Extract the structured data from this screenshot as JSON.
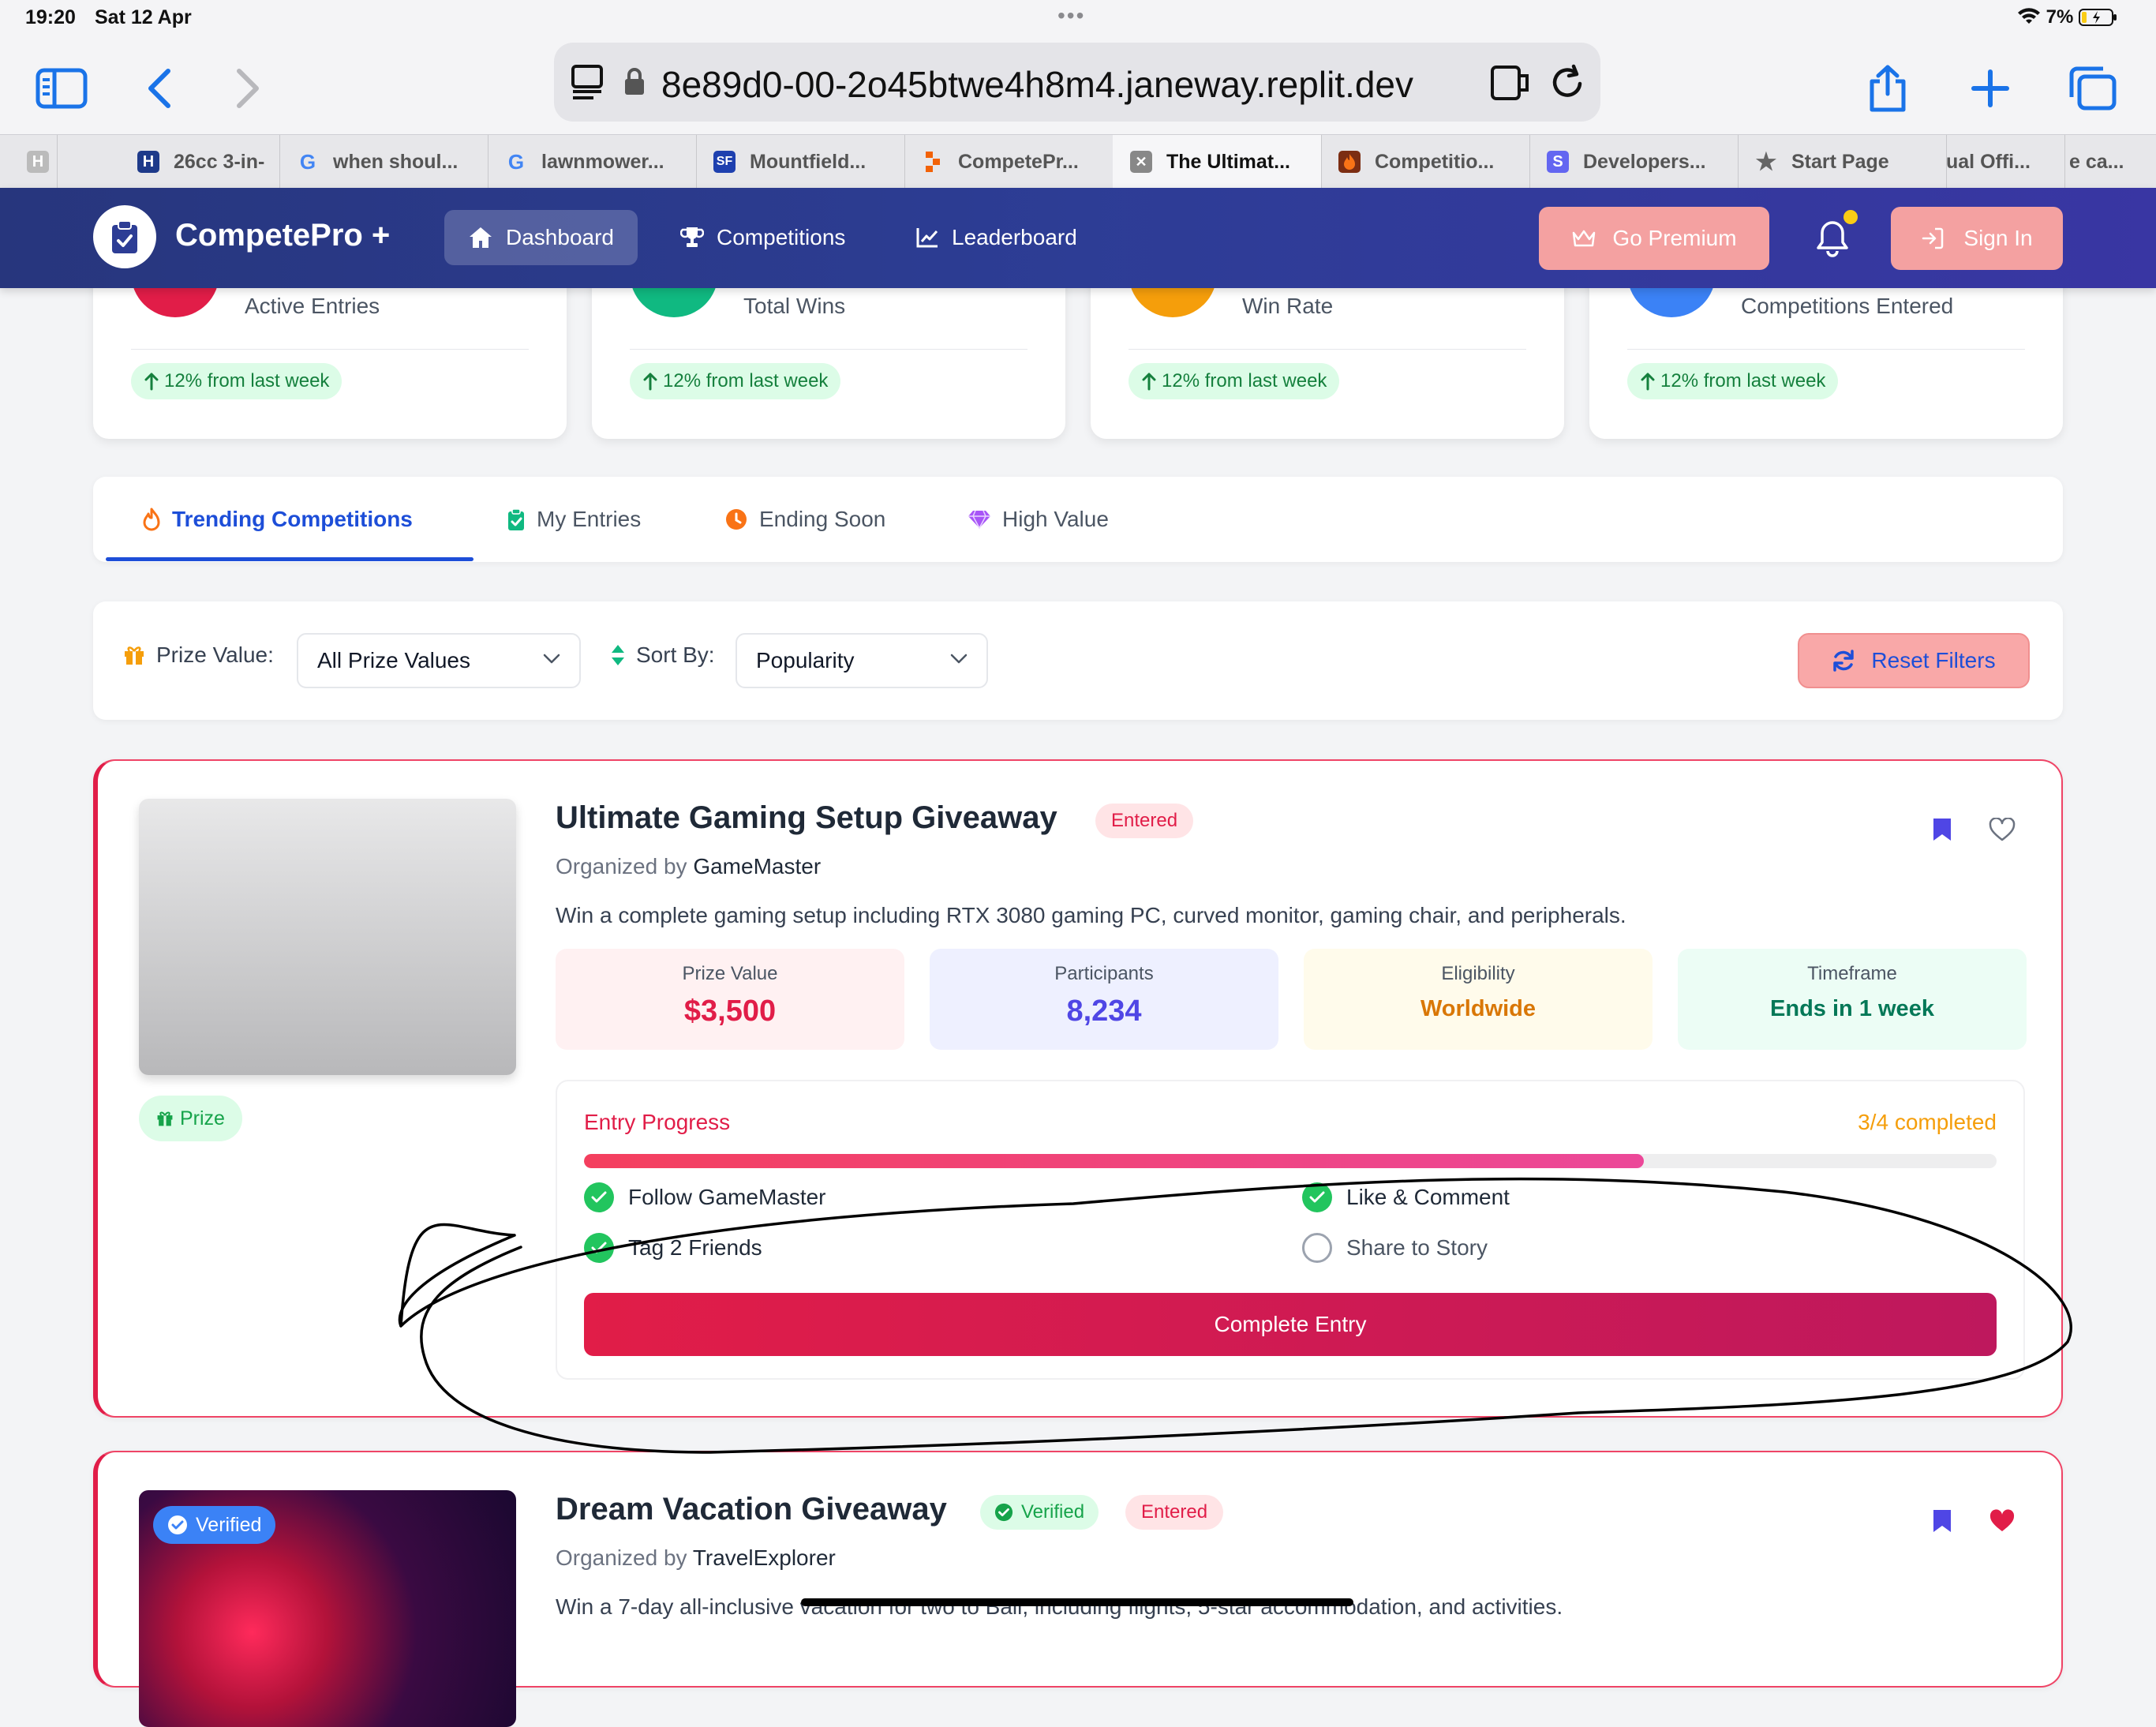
{
  "status_bar": {
    "time": "19:20",
    "date": "Sat 12 Apr",
    "battery": "7%"
  },
  "browser": {
    "url": "8e89d0-00-2o45btwe4h8m4.janeway.replit.dev",
    "tabs": [
      {
        "label": "",
        "icon": "h-icon"
      },
      {
        "label": "26cc 3-in-",
        "icon": "h-brand-icon"
      },
      {
        "label": "when shoul...",
        "icon": "google-icon"
      },
      {
        "label": "lawnmower...",
        "icon": "google-icon"
      },
      {
        "label": "Mountfield...",
        "icon": "sf-icon"
      },
      {
        "label": "CompetePr...",
        "icon": "replit-icon"
      },
      {
        "label": "The Ultimat...",
        "icon": "close-box-icon"
      },
      {
        "label": "Competitio...",
        "icon": "fire-app-icon"
      },
      {
        "label": "Developers...",
        "icon": "s-icon"
      },
      {
        "label": "Start Page",
        "icon": "star-icon"
      },
      {
        "label": "ual Offi...",
        "icon": ""
      },
      {
        "label": "e ca...",
        "icon": ""
      }
    ]
  },
  "nav": {
    "brand": "CompetePro +",
    "items": [
      {
        "label": "Dashboard",
        "icon": "home-icon"
      },
      {
        "label": "Competitions",
        "icon": "trophy-icon"
      },
      {
        "label": "Leaderboard",
        "icon": "chart-line-icon"
      }
    ],
    "premium_label": "Go Premium",
    "signin_label": "Sign In"
  },
  "stats": [
    {
      "label": "Active Entries",
      "trend": "12% from last week",
      "color": "#e11d48"
    },
    {
      "label": "Total Wins",
      "trend": "12% from last week",
      "color": "#10b981"
    },
    {
      "label": "Win Rate",
      "trend": "12% from last week",
      "color": "#f59e0b"
    },
    {
      "label": "Competitions Entered",
      "trend": "12% from last week",
      "color": "#3b82f6"
    }
  ],
  "tabs": [
    {
      "label": "Trending Competitions",
      "icon": "fire-icon"
    },
    {
      "label": "My Entries",
      "icon": "clipboard-check-icon"
    },
    {
      "label": "Ending Soon",
      "icon": "clock-icon"
    },
    {
      "label": "High Value",
      "icon": "gem-icon"
    }
  ],
  "filters": {
    "prize_label": "Prize Value:",
    "prize_value": "All Prize Values",
    "sort_label": "Sort By:",
    "sort_value": "Popularity",
    "reset_label": "Reset Filters"
  },
  "cards": [
    {
      "title": "Ultimate Gaming Setup Giveaway",
      "entered_label": "Entered",
      "organized_prefix": "Organized by",
      "organizer": "GameMaster",
      "description": "Win a complete gaming setup including RTX 3080 gaming PC, curved monitor, gaming chair, and peripherals.",
      "badge": "Prize",
      "details": [
        {
          "label": "Prize Value",
          "value": "$3,500"
        },
        {
          "label": "Participants",
          "value": "8,234"
        },
        {
          "label": "Eligibility",
          "value": "Worldwide"
        },
        {
          "label": "Timeframe",
          "value": "Ends in 1 week"
        }
      ],
      "progress": {
        "title": "Entry Progress",
        "count": "3/4 completed",
        "fraction": 0.75,
        "tasks": [
          {
            "label": "Follow GameMaster",
            "done": true
          },
          {
            "label": "Like & Comment",
            "done": true
          },
          {
            "label": "Tag 2 Friends",
            "done": true
          },
          {
            "label": "Share to Story",
            "done": false
          }
        ],
        "button": "Complete Entry"
      }
    },
    {
      "title": "Dream Vacation Giveaway",
      "verified_label": "Verified",
      "entered_label": "Entered",
      "organized_prefix": "Organized by",
      "organizer": "TravelExplorer",
      "description": "Win a 7-day all-inclusive vacation for two to Bali, including flights, 5-star accommodation, and activities.",
      "badge": "Verified"
    }
  ]
}
